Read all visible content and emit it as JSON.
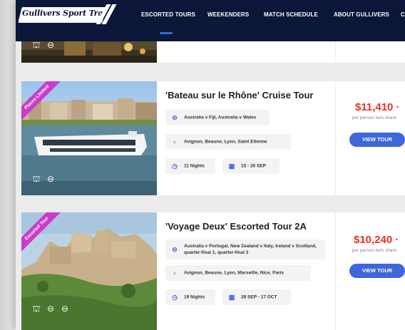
{
  "nav": {
    "logo": "Gullivers Sport Travel",
    "items": [
      "ESCORTED TOURS",
      "WEEKENDERS",
      "MATCH SCHEDULE",
      "ABOUT GULLIVERS",
      "C"
    ],
    "active": "ESCORTED TOURS"
  },
  "tours": [
    {
      "ribbon": "Places Limited",
      "title": "'Bateau sur le Rhône' Cruise Tour",
      "matches": "Australia v Fiji, Australia v Wales",
      "cities": "Avignon, Beaune, Lyon, Saint Etienne",
      "nights": "11 Nights",
      "dates": "15 - 26 SEP",
      "price": "$11,410",
      "price_suffix": "·",
      "price_note": "per person twin share",
      "button": "VIEW TOUR",
      "img_icons": [
        "stadium-icon",
        "rugby-ball-icon"
      ]
    },
    {
      "ribbon": "Escorted Tour",
      "title": "'Voyage Deux' Escorted Tour 2A",
      "matches": "Australia v Portugal, New Zealand v Italy, Ireland v Scotland, quarter-final 1, quarter-final 3",
      "cities": "Avignon, Beaune, Lyon, Marseille, Nice, Paris",
      "nights": "19 Nights",
      "dates": "28 SEP - 17 OCT",
      "price": "$10,240",
      "price_suffix": "·",
      "price_note": "per person twin share",
      "button": "VIEW TOUR",
      "img_icons": [
        "stadium-icon",
        "rugby-ball-icon",
        "rugby-ball-icon"
      ]
    }
  ],
  "colors": {
    "nav_bg": "#0b1639",
    "accent": "#3f66da",
    "price": "#e8302a",
    "ribbon": "#c93cc9"
  }
}
